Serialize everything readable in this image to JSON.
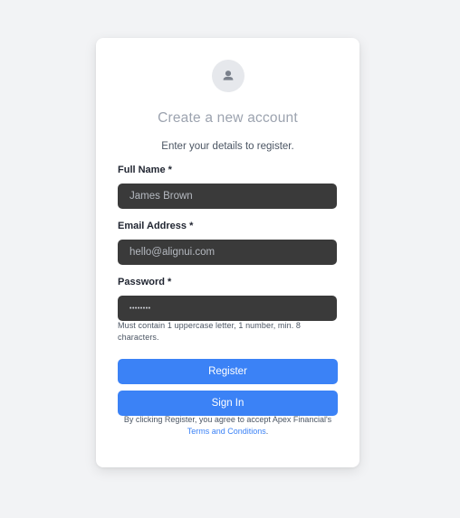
{
  "header": {
    "title": "Create a new account",
    "subtitle": "Enter your details to register."
  },
  "form": {
    "full_name": {
      "label": "Full Name *",
      "placeholder": "James Brown"
    },
    "email": {
      "label": "Email Address *",
      "placeholder": "hello@alignui.com"
    },
    "password": {
      "label": "Password *",
      "value": "••••••••",
      "hint": "Must contain 1 uppercase letter, 1 number, min. 8 characters."
    }
  },
  "actions": {
    "register_label": "Register",
    "signin_label": "Sign In"
  },
  "legal": {
    "prefix": "By clicking Register, you agree to accept Apex Financial's",
    "link_text": "Terms and Conditions",
    "suffix": "."
  },
  "icons": {
    "avatar": "user-icon"
  },
  "colors": {
    "page_background": "#f2f3f5",
    "card_background": "#ffffff",
    "input_background": "#3a3a3a",
    "accent": "#3b82f6",
    "title_color": "#9ca3af"
  }
}
